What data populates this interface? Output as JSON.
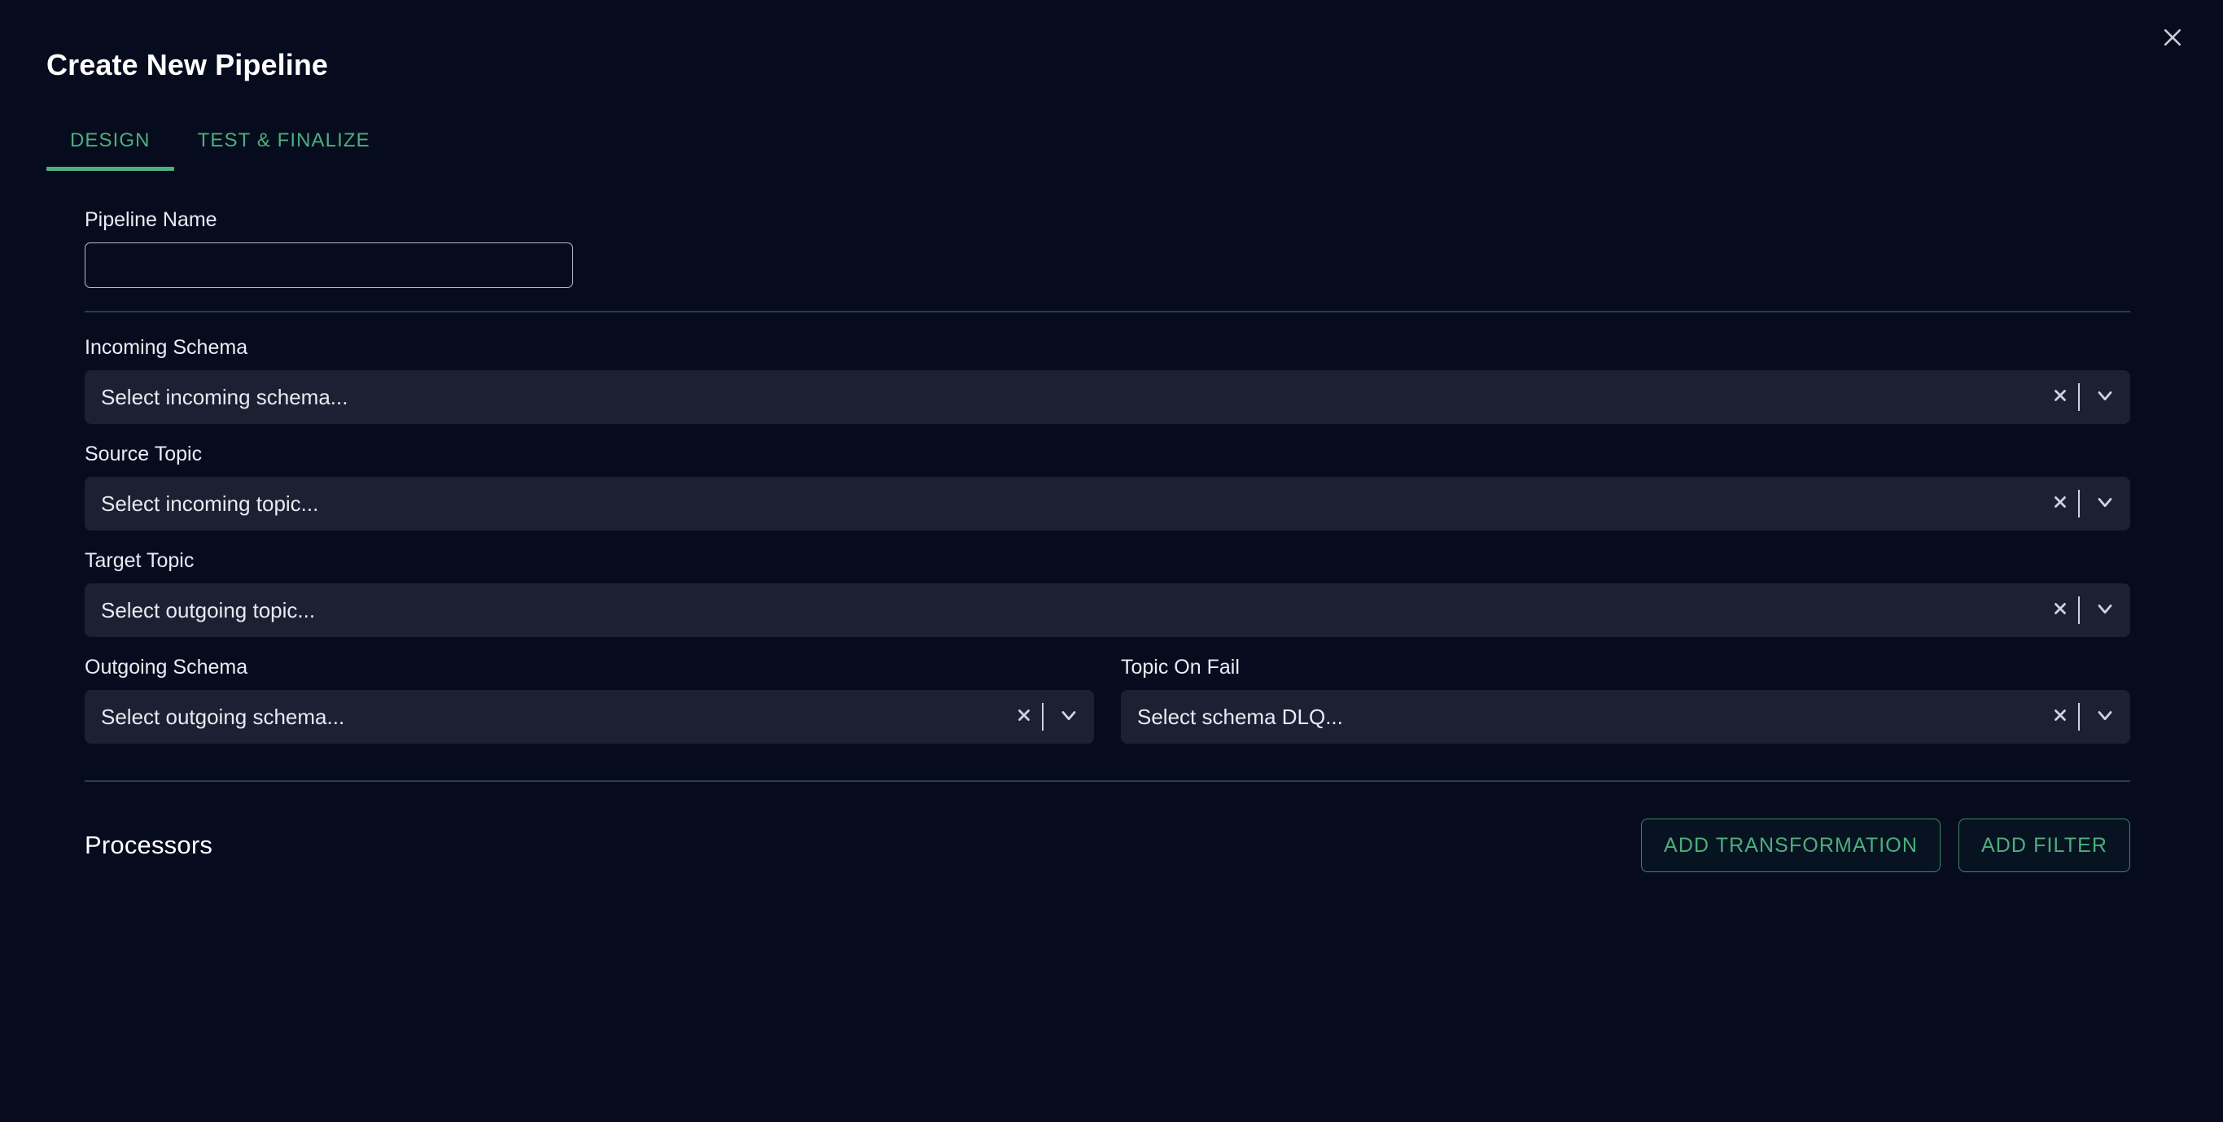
{
  "window": {
    "title": "Create New Pipeline",
    "close_icon": "close-icon"
  },
  "colors": {
    "page_background": "#060c1e",
    "field_background": "#1b2033",
    "accent_green": "#4caf7d",
    "text_primary": "#ffffff",
    "divider": "#343a4d",
    "input_border": "#b9bfce"
  },
  "tabs": [
    {
      "label": "DESIGN",
      "active": true
    },
    {
      "label": "TEST & FINALIZE",
      "active": false
    }
  ],
  "form": {
    "pipeline_name": {
      "label": "Pipeline Name",
      "value": "",
      "placeholder": ""
    },
    "incoming_schema": {
      "label": "Incoming Schema",
      "placeholder": "Select incoming schema...",
      "value": "",
      "clear_icon": "close-icon",
      "dropdown_icon": "chevron-down-icon"
    },
    "source_topic": {
      "label": "Source Topic",
      "placeholder": "Select incoming topic...",
      "value": "",
      "clear_icon": "close-icon",
      "dropdown_icon": "chevron-down-icon"
    },
    "target_topic": {
      "label": "Target Topic",
      "placeholder": "Select outgoing topic...",
      "value": "",
      "clear_icon": "close-icon",
      "dropdown_icon": "chevron-down-icon"
    },
    "outgoing_schema": {
      "label": "Outgoing Schema",
      "placeholder": "Select outgoing schema...",
      "value": "",
      "clear_icon": "close-icon",
      "dropdown_icon": "chevron-down-icon"
    },
    "topic_on_fail": {
      "label": "Topic On Fail",
      "placeholder": "Select schema DLQ...",
      "value": "",
      "clear_icon": "close-icon",
      "dropdown_icon": "chevron-down-icon"
    }
  },
  "processors": {
    "title": "Processors",
    "add_transformation_label": "ADD TRANSFORMATION",
    "add_filter_label": "ADD FILTER"
  }
}
